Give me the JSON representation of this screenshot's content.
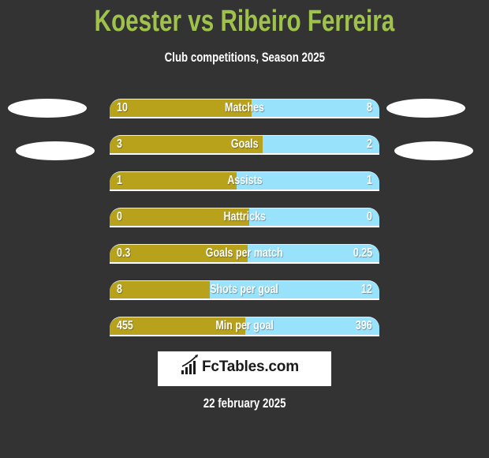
{
  "header": {
    "title": "Koester vs Ribeiro Ferreira",
    "subtitle": "Club competitions, Season 2025"
  },
  "colors": {
    "background": "#333333",
    "title": "#9fc24a",
    "left_player": "#b8a21c",
    "right_player": "#98e3fb"
  },
  "chart_data": {
    "type": "bar",
    "orientation": "horizontal-comparison",
    "title": "Koester vs Ribeiro Ferreira",
    "subtitle": "Club competitions, Season 2025",
    "series": [
      {
        "name": "Koester",
        "side": "left",
        "color": "#b8a21c"
      },
      {
        "name": "Ribeiro Ferreira",
        "side": "right",
        "color": "#98e3fb"
      }
    ],
    "categories": [
      "Matches",
      "Goals",
      "Assists",
      "Hattricks",
      "Goals per match",
      "Shots per goal",
      "Min per goal"
    ],
    "rows": [
      {
        "label": "Matches",
        "left": "10",
        "right": "8",
        "left_share": 0.525
      },
      {
        "label": "Goals",
        "left": "3",
        "right": "2",
        "left_share": 0.566
      },
      {
        "label": "Assists",
        "left": "1",
        "right": "1",
        "left_share": 0.47
      },
      {
        "label": "Hattricks",
        "left": "0",
        "right": "0",
        "left_share": 0.518
      },
      {
        "label": "Goals per match",
        "left": "0.3",
        "right": "0.25",
        "left_share": 0.513
      },
      {
        "label": "Shots per goal",
        "left": "8",
        "right": "12",
        "left_share": 0.37
      },
      {
        "label": "Min per goal",
        "left": "455",
        "right": "396",
        "left_share": 0.504
      }
    ]
  },
  "footer": {
    "brand": "FcTables.com",
    "brand_icon": "bar-chart-trend-icon",
    "date": "22 february 2025"
  }
}
